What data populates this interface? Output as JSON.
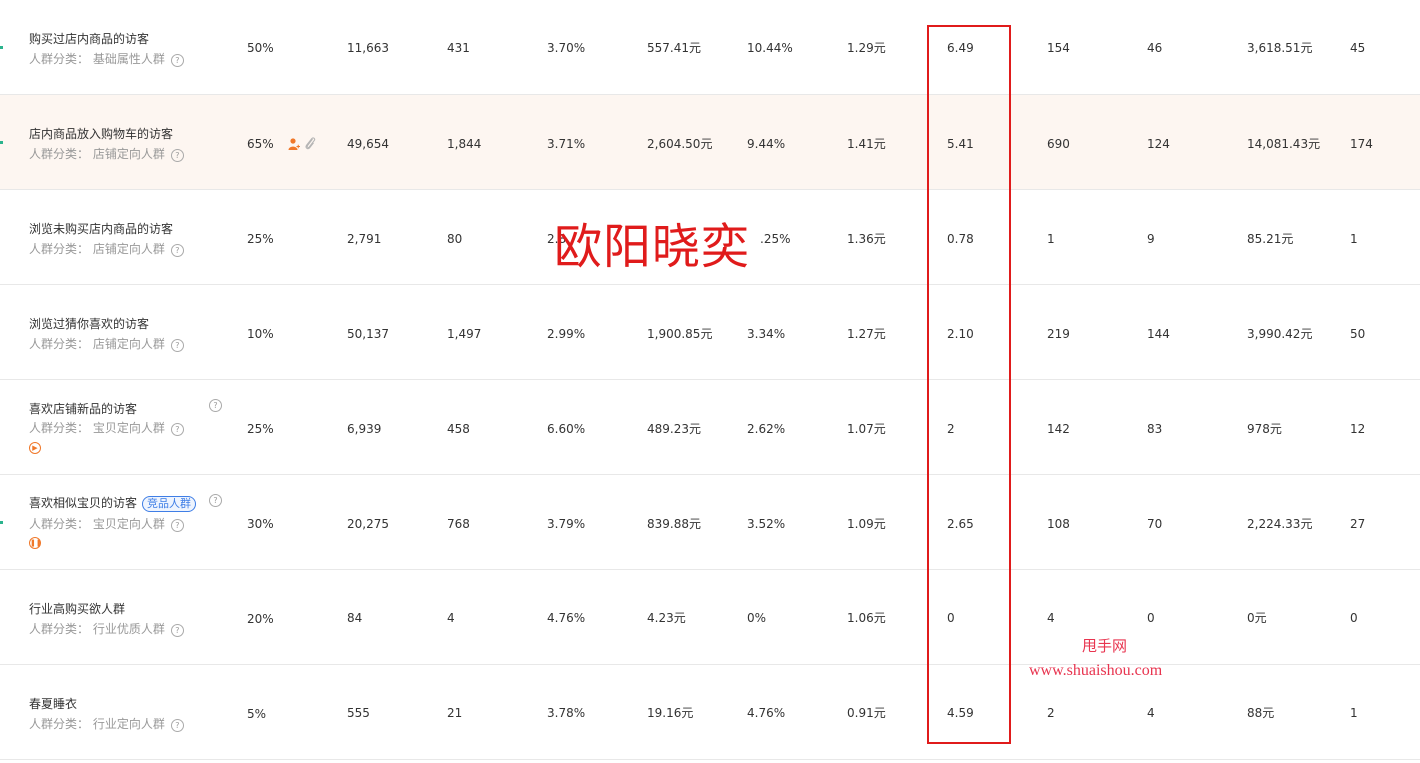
{
  "category_prefix": "人群分类：",
  "help_glyph": "?",
  "rows": [
    {
      "name": "购买过店内商品的访客",
      "category": "基础属性人群",
      "premium": "50%",
      "c1": "11,663",
      "c2": "431",
      "c3": "3.70%",
      "c4": "557.41元",
      "c5": "10.44%",
      "c6": "1.29元",
      "roi": "6.49",
      "c8": "154",
      "c9": "46",
      "c10": "3,618.51元",
      "c11": "45"
    },
    {
      "name": "店内商品放入购物车的访客",
      "category": "店铺定向人群",
      "premium": "65%",
      "c1": "49,654",
      "c2": "1,844",
      "c3": "3.71%",
      "c4": "2,604.50元",
      "c5": "9.44%",
      "c6": "1.41元",
      "roi": "5.41",
      "c8": "690",
      "c9": "124",
      "c10": "14,081.43元",
      "c11": "174"
    },
    {
      "name": "浏览未购买店内商品的访客",
      "category": "店铺定向人群",
      "premium": "25%",
      "c1": "2,791",
      "c2": "80",
      "c3": "2.8",
      "c4": "",
      "c5": ".25%",
      "c6": "1.36元",
      "roi": "0.78",
      "c8": "1",
      "c9": "9",
      "c10": "85.21元",
      "c11": "1"
    },
    {
      "name": "浏览过猜你喜欢的访客",
      "category": "店铺定向人群",
      "premium": "10%",
      "c1": "50,137",
      "c2": "1,497",
      "c3": "2.99%",
      "c4": "1,900.85元",
      "c5": "3.34%",
      "c6": "1.27元",
      "roi": "2.10",
      "c8": "219",
      "c9": "144",
      "c10": "3,990.42元",
      "c11": "50"
    },
    {
      "name": "喜欢店铺新品的访客",
      "category": "宝贝定向人群",
      "premium": "25%",
      "c1": "6,939",
      "c2": "458",
      "c3": "6.60%",
      "c4": "489.23元",
      "c5": "2.62%",
      "c6": "1.07元",
      "roi": "2",
      "c8": "142",
      "c9": "83",
      "c10": "978元",
      "c11": "12"
    },
    {
      "name": "喜欢相似宝贝的访客",
      "tag": "竞品人群",
      "category": "宝贝定向人群",
      "premium": "30%",
      "c1": "20,275",
      "c2": "768",
      "c3": "3.79%",
      "c4": "839.88元",
      "c5": "3.52%",
      "c6": "1.09元",
      "roi": "2.65",
      "c8": "108",
      "c9": "70",
      "c10": "2,224.33元",
      "c11": "27"
    },
    {
      "name": "行业高购买欲人群",
      "category": "行业优质人群",
      "premium": "20%",
      "c1": "84",
      "c2": "4",
      "c3": "4.76%",
      "c4": "4.23元",
      "c5": "0%",
      "c6": "1.06元",
      "roi": "0",
      "c8": "4",
      "c9": "0",
      "c10": "0元",
      "c11": "0"
    },
    {
      "name": "春夏睡衣",
      "category": "行业定向人群",
      "premium": "5%",
      "c1": "555",
      "c2": "21",
      "c3": "3.78%",
      "c4": "19.16元",
      "c5": "4.76%",
      "c6": "0.91元",
      "roi": "4.59",
      "c8": "2",
      "c9": "4",
      "c10": "88元",
      "c11": "1"
    }
  ],
  "watermark": {
    "name": "欧阳晓奕",
    "site_cn": "甩手网",
    "site_url": "www.shuaishou.com"
  },
  "colors": {
    "highlight_box": "#e01b1b",
    "row_highlight_bg": "#fdf6f1",
    "tag_blue": "#3f7ee6",
    "status_orange": "#f0782a",
    "watermark_red": "#e8344f"
  },
  "icons": {
    "help": "question-circle-icon",
    "play": "play-circle-icon",
    "pause": "pause-circle-icon",
    "person": "person-add-icon",
    "clip": "paperclip-icon"
  }
}
